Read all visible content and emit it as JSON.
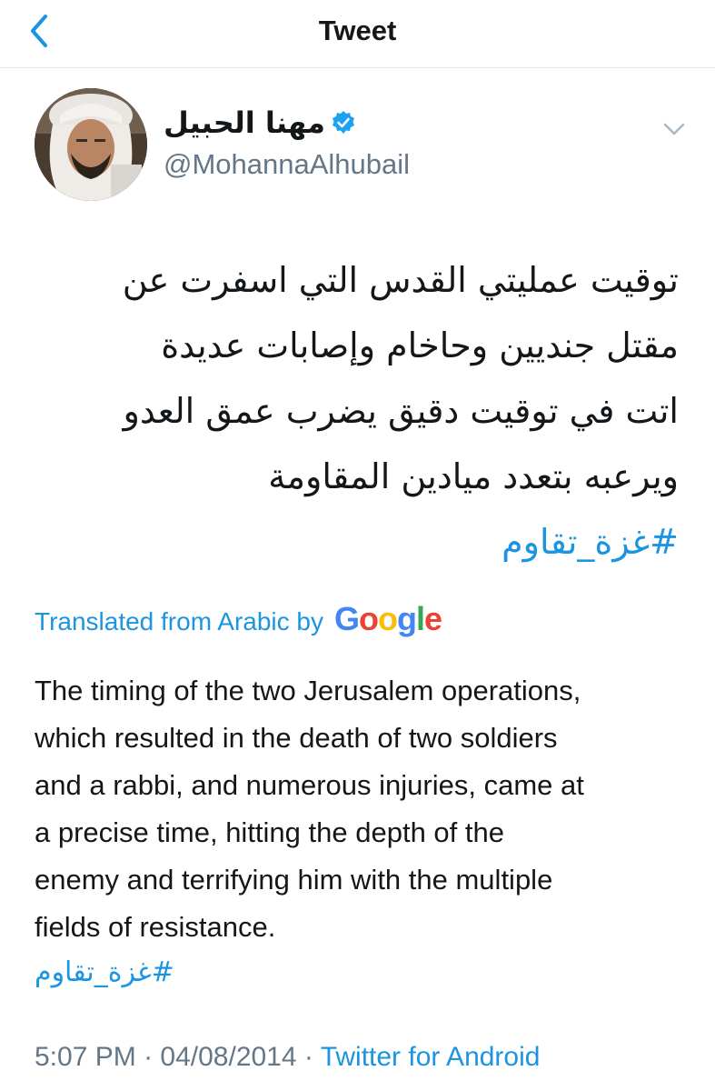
{
  "nav": {
    "title": "Tweet",
    "back_icon": "chevron-left-icon"
  },
  "author": {
    "display_name": "مهنا الحبيل",
    "handle": "@MohannaAlhubail",
    "verified": true,
    "verified_icon": "verified-badge-icon"
  },
  "tweet": {
    "arabic_lines": [
      "توقيت عمليتي القدس التي اسفرت عن",
      "مقتل جنديين وحاخام وإصابات عديدة",
      "اتت في توقيت دقيق يضرب عمق العدو",
      "ويرعبه بتعدد ميادين المقاومة"
    ],
    "hashtag": "#غزة_تقاوم"
  },
  "translation": {
    "label": "Translated from Arabic by",
    "provider_letters": [
      "G",
      "o",
      "o",
      "g",
      "l",
      "e"
    ],
    "lines": [
      "The timing of the two Jerusalem operations,",
      "which resulted in the death of two soldiers",
      "and a rabbi, and numerous injuries, came at",
      "a precise time, hitting the depth of the",
      "enemy and terrifying him with the multiple",
      "fields of resistance."
    ],
    "hashtag": "#غزة_تقاوم"
  },
  "meta": {
    "time": "5:07 PM",
    "separator": " · ",
    "date": "04/08/2014",
    "source": "Twitter for Android"
  },
  "colors": {
    "link": "#1b95e0",
    "secondary": "#657786",
    "text": "#14171a",
    "divider": "#e1e8ed"
  }
}
